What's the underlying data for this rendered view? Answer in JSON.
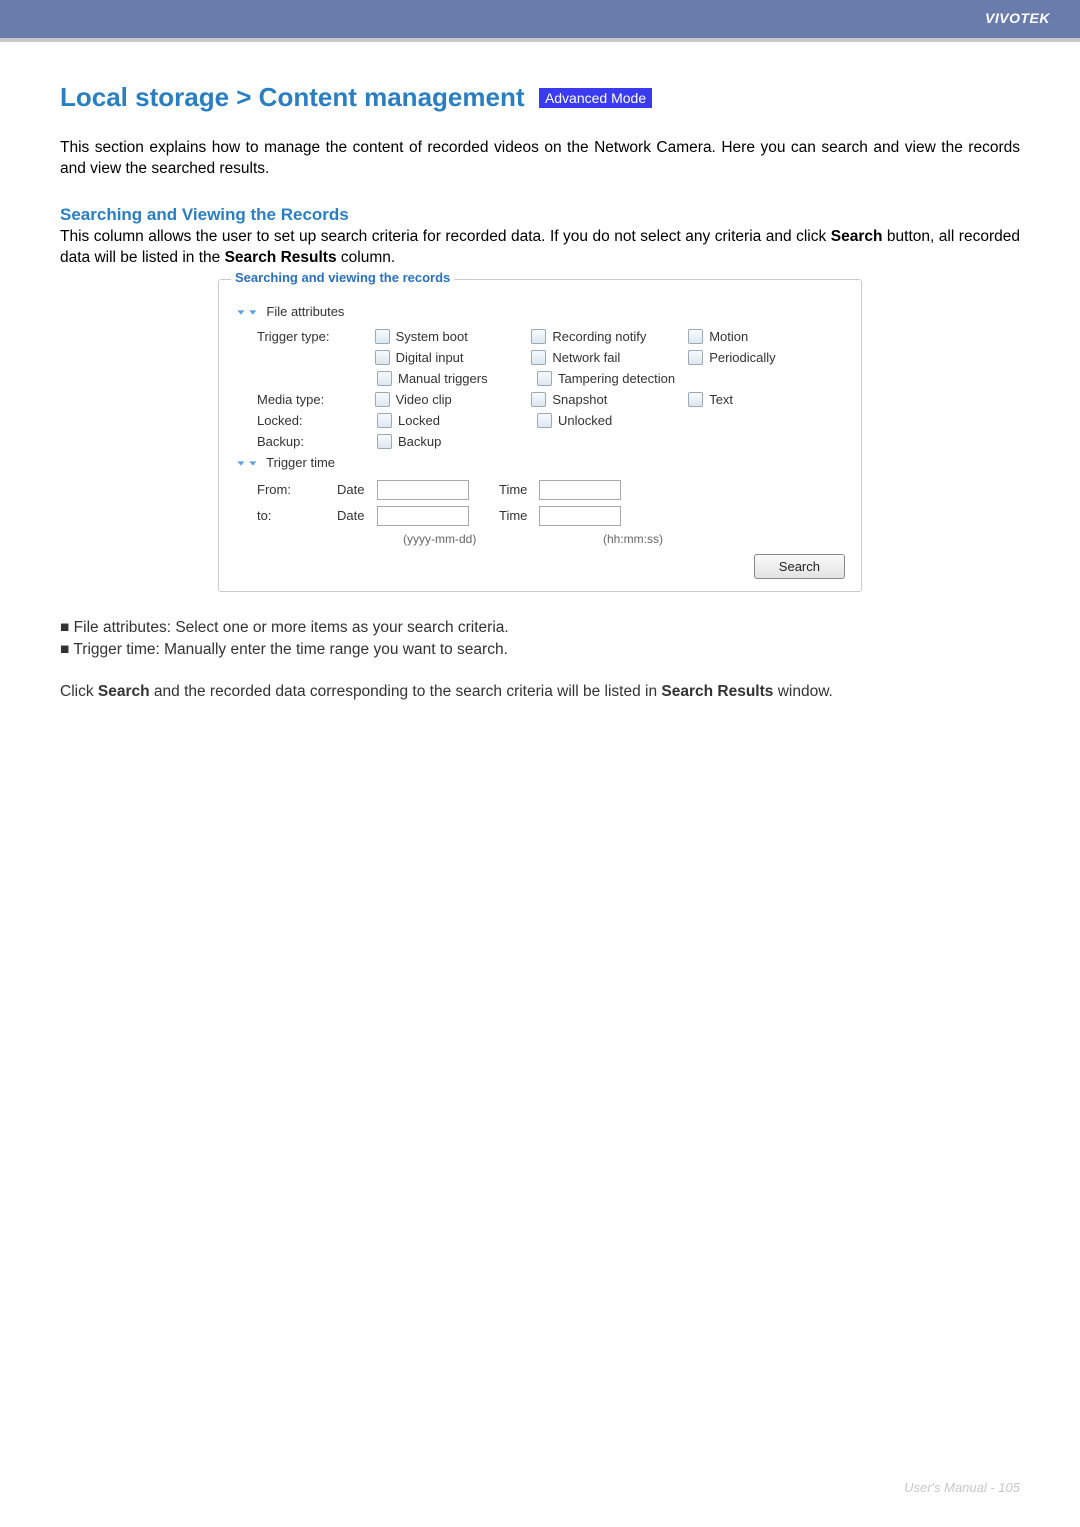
{
  "header": {
    "brand": "VIVOTEK"
  },
  "title": "Local storage > Content management",
  "mode_badge": "Advanced Mode",
  "intro": "This section explains how to manage the content of recorded videos on the Network Camera. Here you can search and view the records and view the searched results.",
  "section_searching": {
    "heading": "Searching and Viewing the Records",
    "desc_pre": "This column allows the user to set up search criteria for recorded data. If you do not select any criteria and click ",
    "desc_search_word": "Search",
    "desc_mid": " button, all recorded data will be listed in the ",
    "desc_results_word": "Search Results",
    "desc_post": " column."
  },
  "panel": {
    "legend": "Searching and viewing the records",
    "file_attributes_label": "File attributes",
    "trigger_type_label": "Trigger type:",
    "trigger_types": {
      "system_boot": "System boot",
      "recording_notify": "Recording notify",
      "motion": "Motion",
      "digital_input": "Digital input",
      "network_fail": "Network fail",
      "periodically": "Periodically",
      "manual_triggers": "Manual triggers",
      "tampering_detection": "Tampering detection"
    },
    "media_type_label": "Media type:",
    "media_types": {
      "video_clip": "Video clip",
      "snapshot": "Snapshot",
      "text": "Text"
    },
    "locked_label": "Locked:",
    "locked_opts": {
      "locked": "Locked",
      "unlocked": "Unlocked"
    },
    "backup_label": "Backup:",
    "backup_opt": "Backup",
    "trigger_time_label": "Trigger time",
    "from_label": "From:",
    "to_label": "to:",
    "date_word": "Date",
    "time_word": "Time",
    "date_hint": "(yyyy-mm-dd)",
    "time_hint": "(hh:mm:ss)",
    "search_button": "Search"
  },
  "bullets": {
    "file_attributes": "File attributes: Select one or more items as your search criteria.",
    "trigger_time": "Trigger time: Manually enter the time range you want to search."
  },
  "closing": {
    "pre": "Click ",
    "search_word": "Search",
    "mid": " and the recorded data corresponding to the search criteria will be listed in ",
    "results_word": "Search Results",
    "post": " window."
  },
  "footer": "User's Manual - 105"
}
